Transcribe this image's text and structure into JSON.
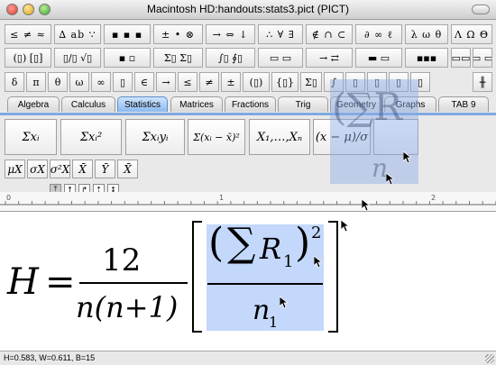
{
  "window": {
    "title": "Macintosh HD:handouts:stats3.pict (PICT)"
  },
  "palette_row1": [
    "≤ ≠ ≈",
    "∆ ab ∵",
    "▪ ▪ ▪",
    "± • ⊗",
    "→ ⇔ ↓",
    "∴ ∀ ∃",
    "∉ ∩ ⊂",
    "∂ ∞ ℓ",
    "λ ω θ",
    "Λ Ω Θ"
  ],
  "palette_row2": [
    "(▯) [▯]",
    "▯/▯ √▯",
    "▪ ▫",
    "Σ▯ Σ▯",
    "∫▯ ∮▯",
    "▭ ▭",
    "→ ⇄",
    "▬ ▭",
    "▪▪▪",
    "▭▭",
    "▭ ▭"
  ],
  "palette_row3": [
    "δ",
    "π",
    "θ",
    "ω",
    "∞",
    "▯",
    "∈",
    "→",
    "≤",
    "≠",
    "±",
    "(▯)",
    "{▯}",
    "Σ▯",
    "∫",
    "▯",
    "▯",
    "▯",
    "▯",
    "╫"
  ],
  "tabs": [
    "Algebra",
    "Calculus",
    "Statistics",
    "Matrices",
    "Fractions",
    "Trig",
    "Geometry",
    "Graphs",
    "TAB 9"
  ],
  "stat_templates": [
    "Σxᵢ",
    "Σxᵢ²",
    "Σxᵢyᵢ",
    "Σ(xᵢ − x̄)²",
    "X₁,…,Xₙ",
    "(x − μ)/σ",
    ""
  ],
  "stat_symbols": [
    "μX",
    "σX",
    "σ²X",
    "X̄",
    "Ȳ",
    "X̄"
  ],
  "ruler": {
    "labels": [
      "0",
      "1",
      "2"
    ]
  },
  "equation": {
    "lhs": "H",
    "equals": "=",
    "numerator": "12",
    "denominator": "n(n+1)",
    "sum": "∑",
    "R": "R",
    "sub1": "1",
    "exp2": "2",
    "n": "n"
  },
  "status": "H=0.583, W=0.611, B=15"
}
